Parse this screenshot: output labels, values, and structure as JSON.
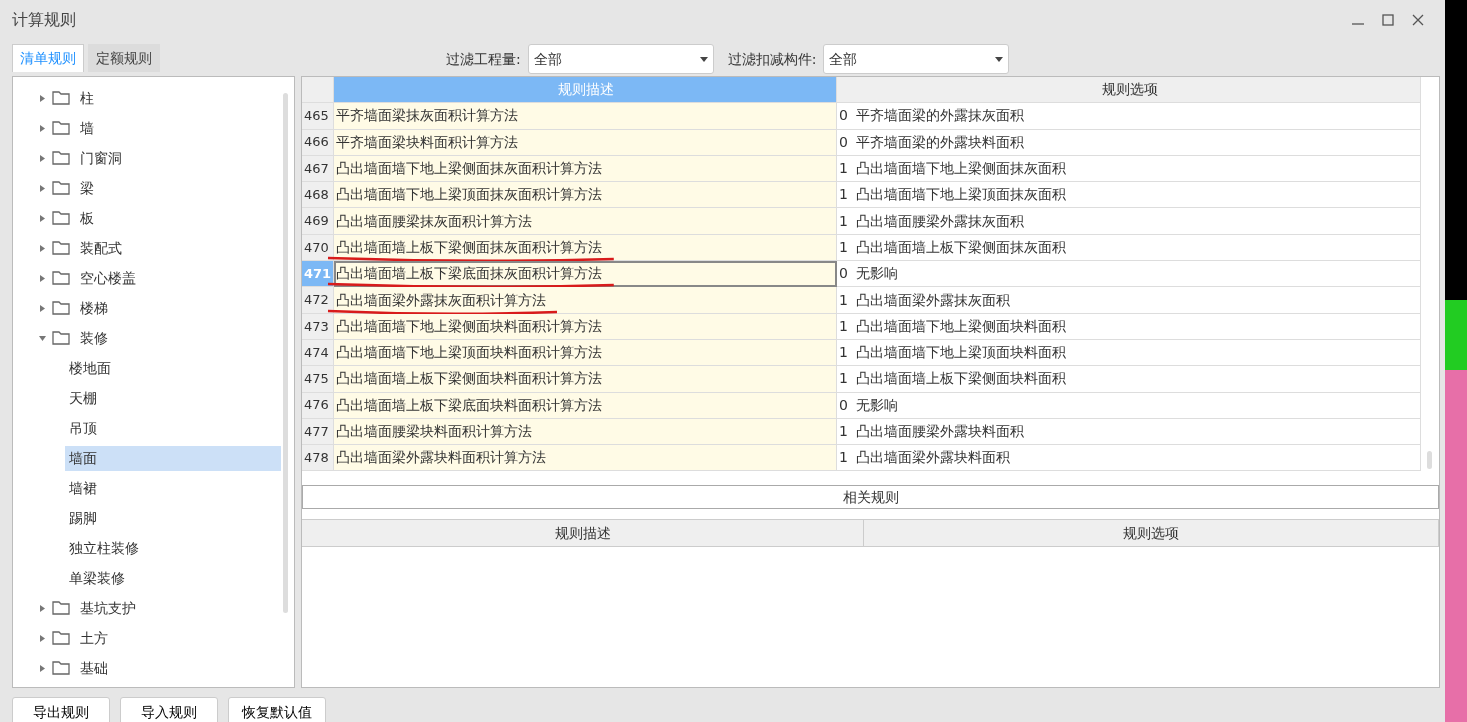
{
  "window": {
    "title": "计算规则"
  },
  "tabs": [
    {
      "label": "清单规则",
      "selected": true
    },
    {
      "label": "定额规则",
      "selected": false
    }
  ],
  "filters": [
    {
      "label": "过滤工程量:",
      "value": "全部"
    },
    {
      "label": "过滤扣减构件:",
      "value": "全部"
    }
  ],
  "tree": [
    {
      "label": "柱",
      "expanded": false
    },
    {
      "label": "墙",
      "expanded": false
    },
    {
      "label": "门窗洞",
      "expanded": false
    },
    {
      "label": "梁",
      "expanded": false
    },
    {
      "label": "板",
      "expanded": false
    },
    {
      "label": "装配式",
      "expanded": false
    },
    {
      "label": "空心楼盖",
      "expanded": false
    },
    {
      "label": "楼梯",
      "expanded": false
    },
    {
      "label": "装修",
      "expanded": true,
      "children": [
        {
          "label": "楼地面",
          "selected": false
        },
        {
          "label": "天棚",
          "selected": false
        },
        {
          "label": "吊顶",
          "selected": false
        },
        {
          "label": "墙面",
          "selected": true
        },
        {
          "label": "墙裙",
          "selected": false
        },
        {
          "label": "踢脚",
          "selected": false
        },
        {
          "label": "独立柱装修",
          "selected": false
        },
        {
          "label": "单梁装修",
          "selected": false
        }
      ]
    },
    {
      "label": "基坑支护",
      "expanded": false
    },
    {
      "label": "土方",
      "expanded": false
    },
    {
      "label": "基础",
      "expanded": false
    }
  ],
  "rules_table": {
    "columns": [
      {
        "label": "规则描述",
        "selected": true
      },
      {
        "label": "规则选项",
        "selected": false
      }
    ],
    "rows": [
      {
        "number": "465",
        "description": "平齐墙面梁抹灰面积计算方法",
        "option_code": "0",
        "option": "平齐墙面梁的外露抹灰面积",
        "selected": false,
        "marked": false
      },
      {
        "number": "466",
        "description": "平齐墙面梁块料面积计算方法",
        "option_code": "0",
        "option": "平齐墙面梁的外露块料面积",
        "selected": false,
        "marked": false
      },
      {
        "number": "467",
        "description": "凸出墙面墙下地上梁侧面抹灰面积计算方法",
        "option_code": "1",
        "option": "凸出墙面墙下地上梁侧面抹灰面积",
        "selected": false,
        "marked": false
      },
      {
        "number": "468",
        "description": "凸出墙面墙下地上梁顶面抹灰面积计算方法",
        "option_code": "1",
        "option": "凸出墙面墙下地上梁顶面抹灰面积",
        "selected": false,
        "marked": false
      },
      {
        "number": "469",
        "description": "凸出墙面腰梁抹灰面积计算方法",
        "option_code": "1",
        "option": "凸出墙面腰梁外露抹灰面积",
        "selected": false,
        "marked": false
      },
      {
        "number": "470",
        "description": "凸出墙面墙上板下梁侧面抹灰面积计算方法",
        "option_code": "1",
        "option": "凸出墙面墙上板下梁侧面抹灰面积",
        "selected": false,
        "marked": true
      },
      {
        "number": "471",
        "description": "凸出墙面墙上板下梁底面抹灰面积计算方法",
        "option_code": "0",
        "option": "无影响",
        "selected": true,
        "marked": true
      },
      {
        "number": "472",
        "description": "凸出墙面梁外露抹灰面积计算方法",
        "option_code": "1",
        "option": "凸出墙面梁外露抹灰面积",
        "selected": false,
        "marked": true
      },
      {
        "number": "473",
        "description": "凸出墙面墙下地上梁侧面块料面积计算方法",
        "option_code": "1",
        "option": "凸出墙面墙下地上梁侧面块料面积",
        "selected": false,
        "marked": false
      },
      {
        "number": "474",
        "description": "凸出墙面墙下地上梁顶面块料面积计算方法",
        "option_code": "1",
        "option": "凸出墙面墙下地上梁顶面块料面积",
        "selected": false,
        "marked": false
      },
      {
        "number": "475",
        "description": "凸出墙面墙上板下梁侧面块料面积计算方法",
        "option_code": "1",
        "option": "凸出墙面墙上板下梁侧面块料面积",
        "selected": false,
        "marked": false
      },
      {
        "number": "476",
        "description": "凸出墙面墙上板下梁底面块料面积计算方法",
        "option_code": "0",
        "option": "无影响",
        "selected": false,
        "marked": false
      },
      {
        "number": "477",
        "description": "凸出墙面腰梁块料面积计算方法",
        "option_code": "1",
        "option": "凸出墙面腰梁外露块料面积",
        "selected": false,
        "marked": false
      },
      {
        "number": "478",
        "description": "凸出墙面梁外露块料面积计算方法",
        "option_code": "1",
        "option": "凸出墙面梁外露块料面积",
        "selected": false,
        "marked": false
      }
    ]
  },
  "related": {
    "title": "相关规则",
    "columns": [
      "规则描述",
      "规则选项"
    ]
  },
  "buttons": [
    "导出规则",
    "导入规则",
    "恢复默认值"
  ]
}
